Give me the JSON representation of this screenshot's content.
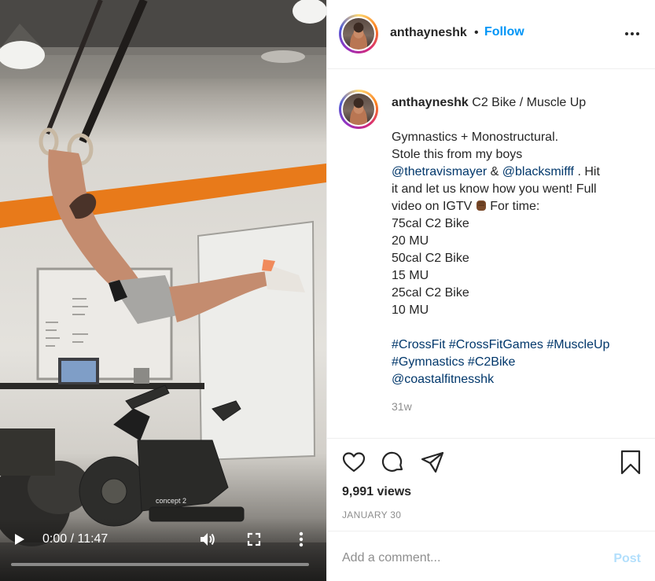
{
  "video": {
    "time": "0:00 / 11:47",
    "progress": 0,
    "controls": {
      "play_icon": "play-icon",
      "volume_icon": "volume-icon",
      "fullscreen_icon": "fullscreen-icon",
      "more_icon": "more-vertical-icon"
    },
    "scene_text": {
      "bike_brand": "concept 2"
    }
  },
  "header": {
    "username": "anthayneshk",
    "separator": "•",
    "follow_label": "Follow",
    "options_icon": "more-horizontal-icon"
  },
  "caption": {
    "username": "anthayneshk",
    "title": "C2 Bike / Muscle Up",
    "line1": "Gymnastics + Monostructural.",
    "line2": "Stole this from my boys",
    "mention1": "@thetravismayer",
    "amp": "&",
    "mention2": "@blacksmifff",
    "line3_tail": ". Hit",
    "line4": "it and let us know how you went! Full",
    "line5_a": "video on IGTV",
    "line5_b": "For time:",
    "workout": [
      "75cal C2 Bike",
      "20 MU",
      "50cal C2 Bike",
      "15 MU",
      "25cal C2 Bike",
      "10 MU"
    ],
    "hashtags_line1": [
      "#CrossFit",
      "#CrossFitGames",
      "#MuscleUp"
    ],
    "hashtags_line2": [
      "#Gymnastics",
      "#C2Bike"
    ],
    "mention3": "@coastalfitnesshk",
    "time_ago": "31w"
  },
  "actions": {
    "like_icon": "heart-icon",
    "comment_icon": "comment-icon",
    "share_icon": "share-icon",
    "save_icon": "bookmark-icon"
  },
  "stats": {
    "views": "9,991 views",
    "date": "JANUARY 30"
  },
  "comment": {
    "placeholder": "Add a comment...",
    "post_label": "Post"
  },
  "colors": {
    "accent": "#0095f6",
    "link": "#00376b",
    "muted": "#8e8e8e",
    "post_disabled": "#b2dffc"
  }
}
